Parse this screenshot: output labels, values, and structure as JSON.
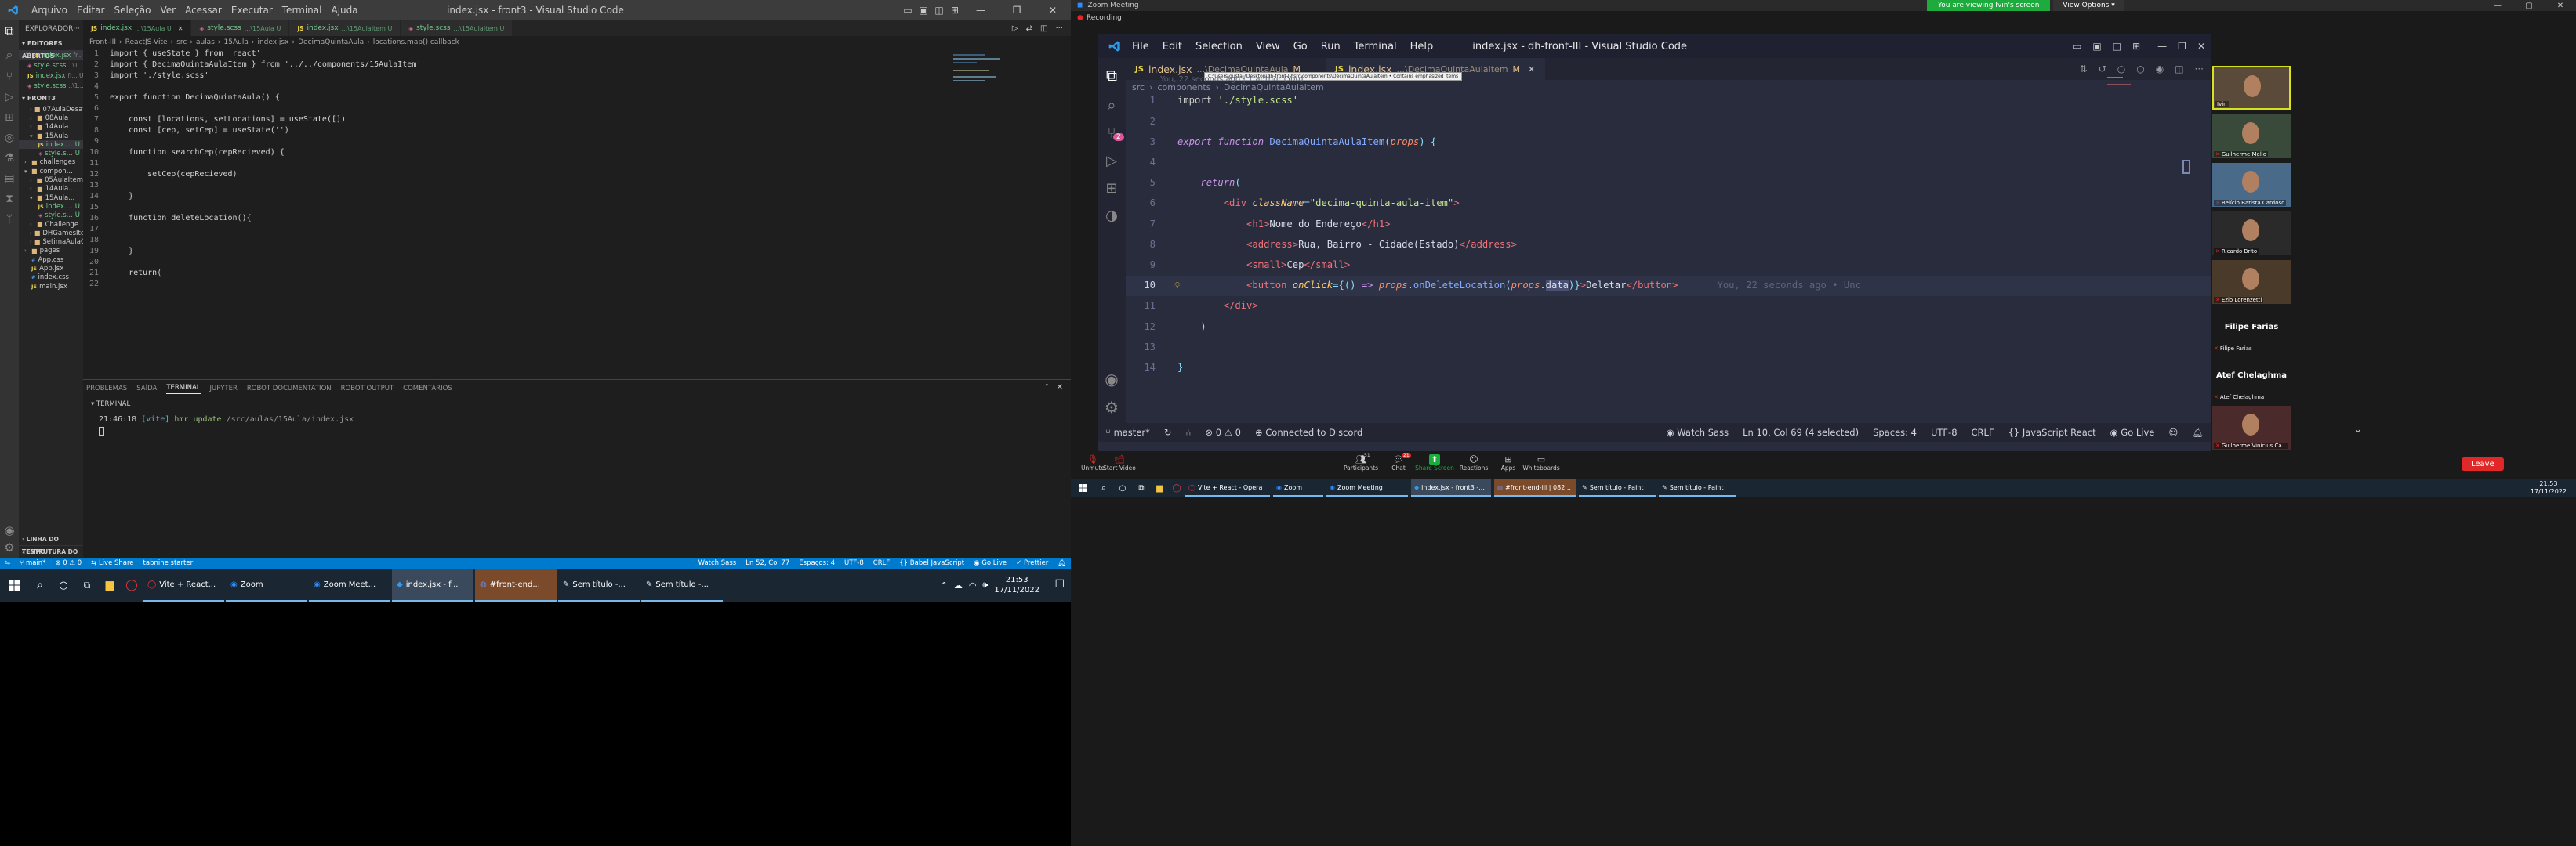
{
  "left": {
    "window_title": "index.jsx - front3 - Visual Studio Code",
    "menu": [
      "Arquivo",
      "Editar",
      "Seleção",
      "Ver",
      "Acessar",
      "Executar",
      "Terminal",
      "Ajuda"
    ],
    "explorer": {
      "title": "EXPLORADOR",
      "open_editors_title": "EDITORES ABERTOS",
      "open_editors": [
        {
          "name": "index.jsx",
          "path": "fr... U",
          "type": "js",
          "active": true
        },
        {
          "name": "style.scss",
          "path": "..\\1... U",
          "type": "scss"
        },
        {
          "name": "index.jsx",
          "path": "fr... U",
          "type": "js"
        },
        {
          "name": "style.scss",
          "path": "..\\1... U",
          "type": "scss"
        }
      ],
      "root_title": "FRONT3",
      "tree": [
        {
          "name": "07AulaDesaf...",
          "type": "folder",
          "depth": 2,
          "open": false
        },
        {
          "name": "08Aula",
          "type": "folder",
          "depth": 2,
          "open": false
        },
        {
          "name": "14Aula",
          "type": "folder",
          "depth": 2,
          "open": false
        },
        {
          "name": "15Aula",
          "type": "folder",
          "depth": 2,
          "open": true
        },
        {
          "name": "index....",
          "type": "js",
          "depth": 3,
          "badge": "U",
          "selected": true
        },
        {
          "name": "style.s...",
          "type": "scss",
          "depth": 3,
          "badge": "U"
        },
        {
          "name": "challenges",
          "type": "folder",
          "depth": 1,
          "open": false
        },
        {
          "name": "compon...",
          "type": "folder",
          "depth": 1,
          "open": true
        },
        {
          "name": "05AulaItem",
          "type": "folder",
          "depth": 2,
          "open": false
        },
        {
          "name": "14Aula...",
          "type": "folder",
          "depth": 2,
          "open": false
        },
        {
          "name": "15Aula...",
          "type": "folder",
          "depth": 2,
          "open": true
        },
        {
          "name": "index....",
          "type": "js",
          "depth": 3,
          "badge": "U"
        },
        {
          "name": "style.s...",
          "type": "scss",
          "depth": 3,
          "badge": "U"
        },
        {
          "name": "Challenge",
          "type": "folder",
          "depth": 2,
          "open": false
        },
        {
          "name": "DHGamesIte...",
          "type": "folder",
          "depth": 2,
          "open": false
        },
        {
          "name": "SetimaAulaC...",
          "type": "folder",
          "depth": 2,
          "open": false
        },
        {
          "name": "pages",
          "type": "folder",
          "depth": 1,
          "open": false
        },
        {
          "name": "App.css",
          "type": "css",
          "depth": 1
        },
        {
          "name": "App.jsx",
          "type": "js",
          "depth": 1
        },
        {
          "name": "index.css",
          "type": "css",
          "depth": 1
        },
        {
          "name": "main.jsx",
          "type": "js",
          "depth": 1
        }
      ],
      "outline": "LINHA DO TEMPO",
      "npm": "ESTRUTURA DO CÓDIGO"
    },
    "tabs": [
      {
        "name": "index.jsx",
        "path": "...\\15Aula U",
        "type": "js",
        "active": true
      },
      {
        "name": "style.scss",
        "path": "...\\15Aula U",
        "type": "scss"
      },
      {
        "name": "index.jsx",
        "path": "...\\15AulaItem U",
        "type": "js"
      },
      {
        "name": "style.scss",
        "path": "...\\15AulaItem U",
        "type": "scss"
      }
    ],
    "breadcrumb": [
      "Front-III",
      "ReactJS-Vite",
      "src",
      "aulas",
      "15Aula",
      "index.jsx",
      "DecimaQuintaAula",
      "locations.map() callback"
    ],
    "code": [
      "import { useState } from 'react'",
      "import { DecimaQuintaAulaItem } from '../../components/15AulaItem'",
      "import './style.scss'",
      "",
      "export function DecimaQuintaAula() {",
      "",
      "    const [locations, setLocations] = useState([])",
      "    const [cep, setCep] = useState('')",
      "",
      "    function searchCep(cepRecieved) {",
      "",
      "        setCep(cepRecieved)",
      "",
      "    }",
      "",
      "    function deleteLocation(){",
      "",
      "",
      "    }",
      "",
      "    return(",
      ""
    ],
    "panel_tabs": [
      "PROBLEMAS",
      "SAÍDA",
      "TERMINAL",
      "JUPYTER",
      "ROBOT DOCUMENTATION",
      "ROBOT OUTPUT",
      "COMENTÁRIOS"
    ],
    "terminal_header": "TERMINAL",
    "terminal_line": {
      "time": "21:46:18",
      "tag": "[vite]",
      "msg": "hmr update",
      "path": "/src/aulas/15Aula/index.jsx"
    },
    "status": {
      "branch": "main*",
      "errors": "⊗ 0 ⚠ 0",
      "live_share": "Live Share",
      "tabnine": "tabnine starter",
      "watch": "Watch Sass",
      "pos": "Ln 52, Col 77",
      "spaces": "Espaços: 4",
      "enc": "UTF-8",
      "eol": "CRLF",
      "lang": "Babel JavaScript",
      "golive": "Go Live",
      "prettier": "Prettier"
    },
    "taskbar": {
      "apps": [
        "Vite + React...",
        "Zoom",
        "Zoom Meet...",
        "index.jsx - f...",
        "#front-end...",
        "Sem título -...",
        "Sem título -..."
      ],
      "time": "21:53",
      "date": "17/11/2022"
    }
  },
  "zoom": {
    "title": "Zoom Meeting",
    "recording": "Recording",
    "viewing_banner": "You are viewing Ivin's screen",
    "view_options": "View Options",
    "shared": {
      "window_title": "index.jsx - dh-front-III - Visual Studio Code",
      "menu": [
        "File",
        "Edit",
        "Selection",
        "View",
        "Go",
        "Run",
        "Terminal",
        "Help"
      ],
      "tabs": [
        {
          "name": "index.jsx",
          "path": "...\\DecimaQuintaAula",
          "badge": "M",
          "active": false
        },
        {
          "name": "index.jsx",
          "path": "...\\DecimaQuintaAulaItem",
          "badge": "M",
          "active": true
        }
      ],
      "breadcrumb": [
        "src",
        "components",
        "DecimaQuintaAulaItem"
      ],
      "tooltip": "C:\\Users\\gusta_\\Desktop\\dh-front-III\\src\\components\\DecimaQuintaAulaItem • Contains emphasized items",
      "blame": "You, 22 seconds ago | 1 author (You)",
      "inline_blame": "You, 22 seconds ago • Unc",
      "source_control_badge": "2",
      "code": [
        [
          [
            "s",
            "import "
          ],
          [
            "g",
            "'./style.scss'"
          ]
        ],
        [],
        [
          [
            "k",
            "export "
          ],
          [
            "k",
            "function "
          ],
          [
            "f",
            "DecimaQuintaAulaItem"
          ],
          [
            "p",
            "("
          ],
          [
            "v",
            "props"
          ],
          [
            "p",
            ") {"
          ]
        ],
        [],
        [
          [
            "p",
            "    "
          ],
          [
            "k",
            "return"
          ],
          [
            "p",
            "("
          ]
        ],
        [
          [
            "p",
            "        "
          ],
          [
            "t",
            "<div "
          ],
          [
            "a",
            "className"
          ],
          [
            "p",
            "="
          ],
          [
            "g",
            "\"decima-quinta-aula-item\""
          ],
          [
            "t",
            ">"
          ]
        ],
        [
          [
            "p",
            "            "
          ],
          [
            "t",
            "<h1>"
          ],
          [
            "w",
            "Nome do Endereço"
          ],
          [
            "t",
            "</h1>"
          ]
        ],
        [
          [
            "p",
            "            "
          ],
          [
            "t",
            "<address>"
          ],
          [
            "w",
            "Rua, Bairro - Cidade(Estado)"
          ],
          [
            "t",
            "</address>"
          ]
        ],
        [
          [
            "p",
            "            "
          ],
          [
            "t",
            "<small>"
          ],
          [
            "w",
            "Cep"
          ],
          [
            "t",
            "</small>"
          ]
        ],
        [
          [
            "p",
            "            "
          ],
          [
            "t",
            "<button "
          ],
          [
            "a",
            "onClick"
          ],
          [
            "p",
            "={"
          ],
          [
            "p",
            "() "
          ],
          [
            "k",
            "=> "
          ],
          [
            "v",
            "props"
          ],
          [
            "w",
            "."
          ],
          [
            "f",
            "onDeleteLocation"
          ],
          [
            "p",
            "("
          ],
          [
            "v",
            "props"
          ],
          [
            "w",
            "."
          ],
          [
            "h",
            "data"
          ],
          [
            "p",
            ")}"
          ],
          [
            "t",
            ">"
          ],
          [
            "w",
            "Deletar"
          ],
          [
            "t",
            "</button>"
          ]
        ],
        [
          [
            "p",
            "        "
          ],
          [
            "t",
            "</div>"
          ]
        ],
        [
          [
            "p",
            "    "
          ],
          [
            "p",
            ")"
          ]
        ],
        [],
        [
          [
            "p",
            "}"
          ]
        ]
      ],
      "status": {
        "branch": "master*",
        "problems": "⊗ 0 ⚠ 0",
        "discord": "Connected to Discord",
        "watch": "Watch Sass",
        "pos": "Ln 10, Col 69 (4 selected)",
        "spaces": "Spaces: 4",
        "enc": "UTF-8",
        "eol": "CRLF",
        "lang": "JavaScript React",
        "golive": "Go Live"
      }
    },
    "participants": [
      {
        "name": "Ivin",
        "type": "video",
        "active": true
      },
      {
        "name": "Guilherme Mello",
        "type": "video"
      },
      {
        "name": "Belício Batista Cardoso",
        "type": "video"
      },
      {
        "name": "Ricardo Brito",
        "type": "video"
      },
      {
        "name": "Ezio Lorenzetti",
        "type": "video"
      },
      {
        "name": "Filipe Farias",
        "type": "name"
      },
      {
        "name": "Atef Chelaghma",
        "type": "name"
      },
      {
        "name": "Guilherme Vinícius Ca...",
        "type": "video"
      }
    ],
    "controls": [
      {
        "label": "Unmute",
        "icon": "mic-off-icon"
      },
      {
        "label": "Start Video",
        "icon": "video-off-icon"
      },
      {
        "label": "Participants",
        "icon": "participants-icon",
        "count": "51"
      },
      {
        "label": "Chat",
        "icon": "chat-icon",
        "count": "21"
      },
      {
        "label": "Share Screen",
        "icon": "share-icon"
      },
      {
        "label": "Reactions",
        "icon": "reactions-icon"
      },
      {
        "label": "Apps",
        "icon": "apps-icon"
      },
      {
        "label": "Whiteboards",
        "icon": "whiteboard-icon"
      }
    ],
    "leave": "Leave",
    "taskbar": {
      "apps": [
        "Vite + React - Opera",
        "Zoom",
        "Zoom Meeting",
        "index.jsx - front3 -...",
        "#front-end-iii | 082...",
        "Sem título - Paint",
        "Sem título - Paint"
      ],
      "time": "21:53",
      "date": "17/11/2022"
    }
  },
  "colors": {
    "vscode_blue": "#007acc",
    "zoom_green": "#1cab3c",
    "leave_red": "#e02828"
  }
}
